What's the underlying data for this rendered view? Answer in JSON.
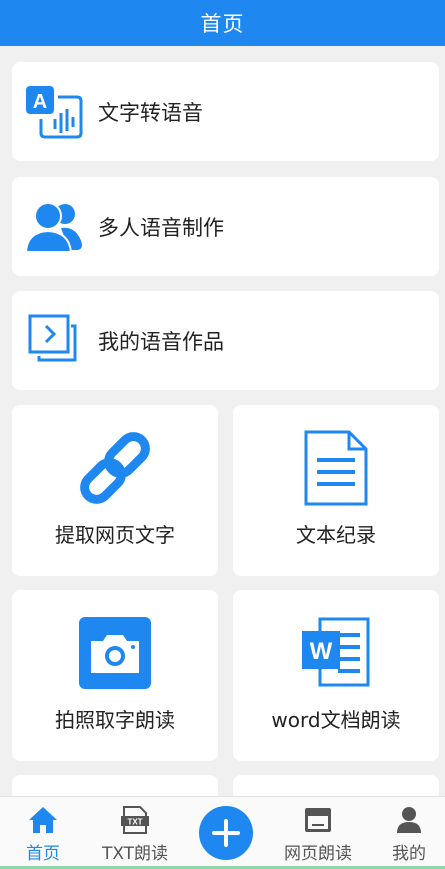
{
  "header": {
    "title": "首页"
  },
  "menu": [
    {
      "label": "文字转语音",
      "icon": "text-to-speech-icon"
    },
    {
      "label": "多人语音制作",
      "icon": "people-icon"
    },
    {
      "label": "我的语音作品",
      "icon": "my-works-icon"
    }
  ],
  "grid": [
    {
      "label": "提取网页文字",
      "icon": "link-icon"
    },
    {
      "label": "文本纪录",
      "icon": "document-icon"
    },
    {
      "label": "拍照取字朗读",
      "icon": "camera-icon"
    },
    {
      "label": "word文档朗读",
      "icon": "word-icon"
    }
  ],
  "tabbar": {
    "home": "首页",
    "txt": "TXT朗读",
    "txt_icon_text": "TXT",
    "add": "add-icon",
    "web": "网页朗读",
    "mine": "我的"
  },
  "colors": {
    "brand": "#1e88f0",
    "background": "#f0f0f0",
    "card": "#ffffff",
    "tab_active": "#1e88f0",
    "tab_inactive": "#555555"
  }
}
